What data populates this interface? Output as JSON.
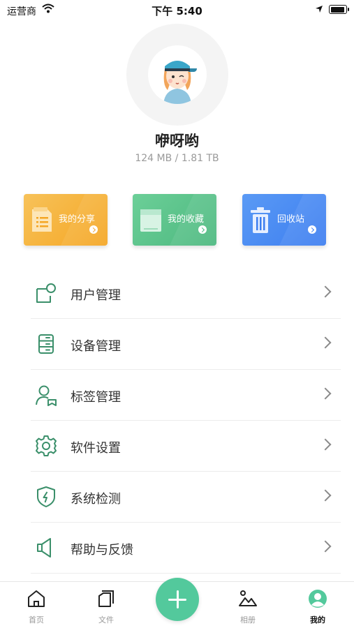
{
  "status_bar": {
    "carrier": "运营商",
    "time": "下午 5:40"
  },
  "profile": {
    "username": "咿呀哟",
    "storage": "124 MB / 1.81 TB"
  },
  "quick_actions": [
    {
      "label": "我的分享",
      "icon": "share-doc-icon"
    },
    {
      "label": "我的收藏",
      "icon": "favorite-doc-icon"
    },
    {
      "label": "回收站",
      "icon": "trash-icon"
    }
  ],
  "menu": [
    {
      "label": "用户管理",
      "icon": "user-manage-icon"
    },
    {
      "label": "设备管理",
      "icon": "device-server-icon"
    },
    {
      "label": "标签管理",
      "icon": "tag-user-icon"
    },
    {
      "label": "软件设置",
      "icon": "gear-icon"
    },
    {
      "label": "系统检测",
      "icon": "shield-bolt-icon"
    },
    {
      "label": "帮助与反馈",
      "icon": "speaker-icon"
    }
  ],
  "tabbar": {
    "tabs": [
      {
        "label": "首页",
        "icon": "home-icon"
      },
      {
        "label": "文件",
        "icon": "files-icon"
      },
      {
        "label": "相册",
        "icon": "photo-album-icon"
      },
      {
        "label": "我的",
        "icon": "profile-icon",
        "active": true
      }
    ],
    "fab_icon": "plus-icon"
  },
  "colors": {
    "accent": "#53c99c",
    "icon_green": "#3a8f6a",
    "share_card": "#f5a623",
    "favorite_card": "#4cb87f",
    "trash_card": "#3d7ef0"
  }
}
